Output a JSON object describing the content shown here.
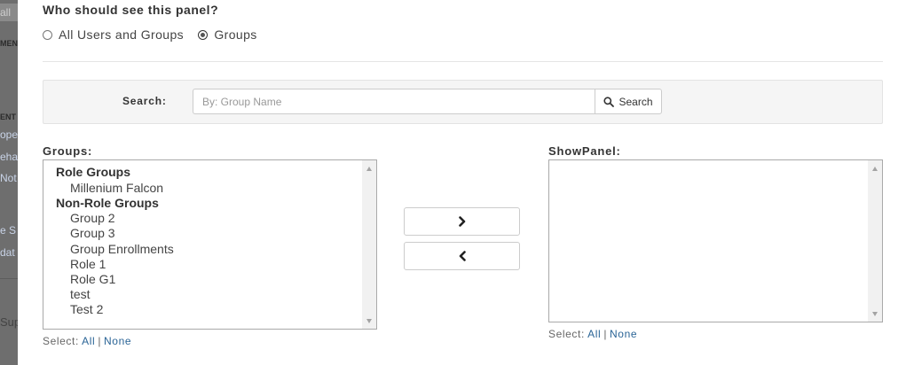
{
  "background": {
    "tab_text": "all",
    "fragments": [
      "MEN",
      "ENT",
      "ope",
      "eha",
      "Not",
      "e S",
      "dat",
      "Sup"
    ]
  },
  "panel_visibility": {
    "title": "Who should see this panel?",
    "options": [
      {
        "label": "All Users and Groups",
        "checked": false
      },
      {
        "label": "Groups",
        "checked": true
      }
    ]
  },
  "search": {
    "label": "Search:",
    "placeholder": "By: Group Name",
    "value": "",
    "button_label": "Search",
    "button_icon": "search-icon"
  },
  "groups_list": {
    "label": "Groups:",
    "optgroups": [
      {
        "label": "Role Groups",
        "options": [
          "Millenium Falcon"
        ]
      },
      {
        "label": "Non-Role Groups",
        "options": [
          "Group 2",
          "Group 3",
          "Group Enrollments",
          "Role 1",
          "Role G1",
          "test",
          "Test 2"
        ]
      }
    ],
    "select_prefix": "Select:",
    "select_all": "All",
    "select_separator": "|",
    "select_none": "None"
  },
  "move_buttons": {
    "add_icon": "chevron-right-icon",
    "remove_icon": "chevron-left-icon"
  },
  "showpanel_list": {
    "label": "ShowPanel:",
    "options": [],
    "select_prefix": "Select:",
    "select_all": "All",
    "select_separator": "|",
    "select_none": "None"
  }
}
